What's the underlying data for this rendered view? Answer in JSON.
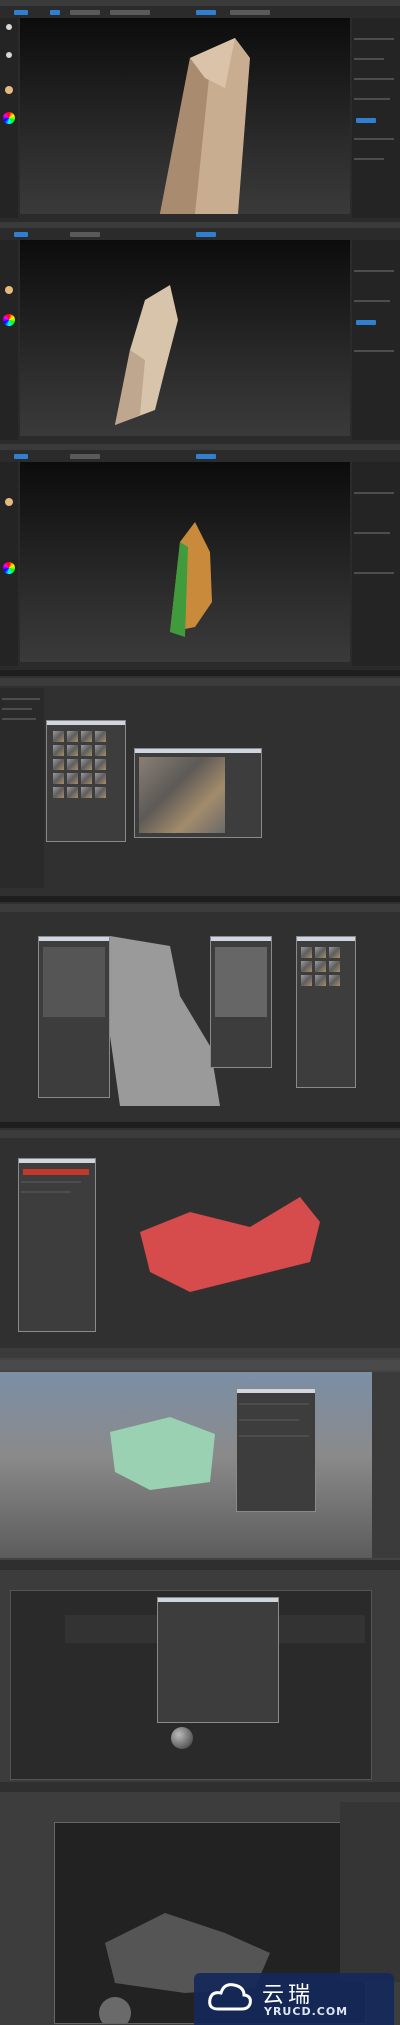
{
  "watermark": {
    "chinese": "云瑞",
    "domain": "YRUCD.COM"
  }
}
